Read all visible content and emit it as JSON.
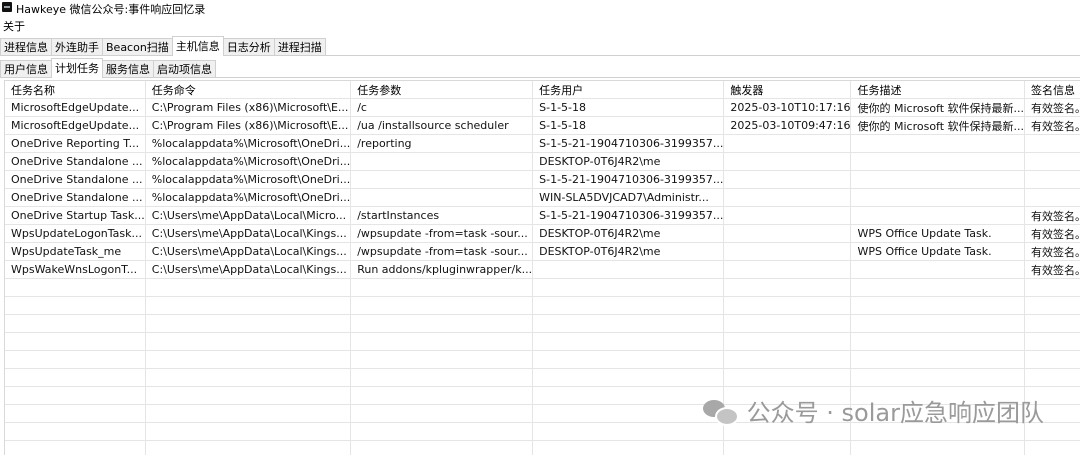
{
  "window": {
    "title": "Hawkeye 微信公众号:事件响应回忆录"
  },
  "menu": {
    "about": "关于"
  },
  "main_tabs": [
    "进程信息",
    "外连助手",
    "Beacon扫描",
    "主机信息",
    "日志分析",
    "进程扫描"
  ],
  "main_tab_active": "主机信息",
  "sub_tabs": [
    "用户信息",
    "计划任务",
    "服务信息",
    "启动项信息"
  ],
  "sub_tab_active": "计划任务",
  "table": {
    "columns": [
      "任务名称",
      "任务命令",
      "任务参数",
      "任务用户",
      "触发器",
      "任务描述",
      "签名信息"
    ],
    "rows": [
      [
        "MicrosoftEdgeUpdate...",
        "C:\\Program Files (x86)\\Microsoft\\E...",
        "/c",
        "S-1-5-18",
        "2025-03-10T10:17:16",
        "使你的 Microsoft 软件保持最新...",
        "有效签名。"
      ],
      [
        "MicrosoftEdgeUpdate...",
        "C:\\Program Files (x86)\\Microsoft\\E...",
        "/ua /installsource scheduler",
        "S-1-5-18",
        "2025-03-10T09:47:16",
        "使你的 Microsoft 软件保持最新...",
        "有效签名。"
      ],
      [
        "OneDrive Reporting T...",
        "%localappdata%\\Microsoft\\OneDri...",
        "/reporting",
        "S-1-5-21-1904710306-3199357...",
        "",
        "",
        ""
      ],
      [
        "OneDrive Standalone ...",
        "%localappdata%\\Microsoft\\OneDri...",
        "",
        "DESKTOP-0T6J4R2\\me",
        "",
        "",
        ""
      ],
      [
        "OneDrive Standalone ...",
        "%localappdata%\\Microsoft\\OneDri...",
        "",
        "S-1-5-21-1904710306-3199357...",
        "",
        "",
        ""
      ],
      [
        "OneDrive Standalone ...",
        "%localappdata%\\Microsoft\\OneDri...",
        "",
        "WIN-SLA5DVJCAD7\\Administr...",
        "",
        "",
        ""
      ],
      [
        "OneDrive Startup Task...",
        "C:\\Users\\me\\AppData\\Local\\Micro...",
        "/startInstances",
        "S-1-5-21-1904710306-3199357...",
        "",
        "",
        "有效签名。"
      ],
      [
        "WpsUpdateLogonTask...",
        "C:\\Users\\me\\AppData\\Local\\Kings...",
        "/wpsupdate -from=task -sour...",
        "DESKTOP-0T6J4R2\\me",
        "",
        "WPS Office Update Task.",
        "有效签名。"
      ],
      [
        "WpsUpdateTask_me",
        "C:\\Users\\me\\AppData\\Local\\Kings...",
        "/wpsupdate -from=task -sour...",
        "DESKTOP-0T6J4R2\\me",
        "",
        "WPS Office Update Task.",
        "有效签名。"
      ],
      [
        "WpsWakeWnsLogonT...",
        "C:\\Users\\me\\AppData\\Local\\Kings...",
        "Run addons/kpluginwrapper/k...",
        "",
        "",
        "",
        "有效签名。"
      ]
    ]
  },
  "watermark": {
    "text": "公众号 · solar应急响应团队"
  }
}
